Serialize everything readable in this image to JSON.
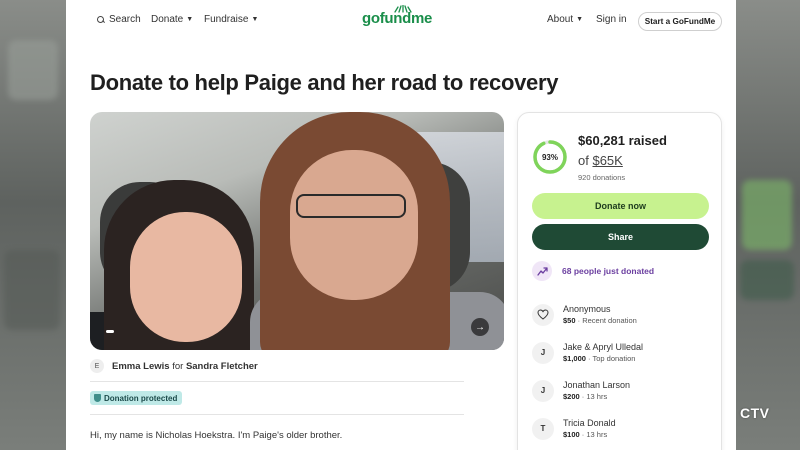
{
  "nav": {
    "search_label": "Search",
    "donate_label": "Donate",
    "fundraise_label": "Fundraise",
    "about_label": "About",
    "signin_label": "Sign in",
    "start_label": "Start a GoFundMe",
    "logo_text": "gofundme",
    "brand_color": "#1a8e4a"
  },
  "campaign": {
    "title": "Donate to help Paige and her road to recovery",
    "organizer": "Emma Lewis",
    "for_word": "for",
    "beneficiary": "Sandra Fletcher",
    "organizer_initial": "E",
    "protected_label": "Donation protected",
    "story_first_line": "Hi, my name is Nicholas Hoekstra. I'm Paige's older brother."
  },
  "progress": {
    "percent_label": "93%",
    "percent_value": 0.93,
    "raised": "$60,281 raised",
    "of_word": "of",
    "goal": "$65K",
    "donation_count": "920 donations",
    "ring_color": "#7fd45a"
  },
  "buttons": {
    "donate": "Donate now",
    "share": "Share"
  },
  "trend": {
    "text": "68 people just donated",
    "color": "#6b3fa0"
  },
  "donors": [
    {
      "name": "Anonymous",
      "amount": "$50",
      "meta": "Recent donation",
      "avatar": "heart-hand-icon",
      "initial": ""
    },
    {
      "name": "Jake & Apryl Ulledal",
      "amount": "$1,000",
      "meta": "Top donation",
      "avatar": "initial",
      "initial": "J"
    },
    {
      "name": "Jonathan Larson",
      "amount": "$200",
      "meta": "13 hrs",
      "avatar": "initial",
      "initial": "J"
    },
    {
      "name": "Tricia Donald",
      "amount": "$100",
      "meta": "13 hrs",
      "avatar": "initial",
      "initial": "T"
    }
  ],
  "watermark": "CTV"
}
